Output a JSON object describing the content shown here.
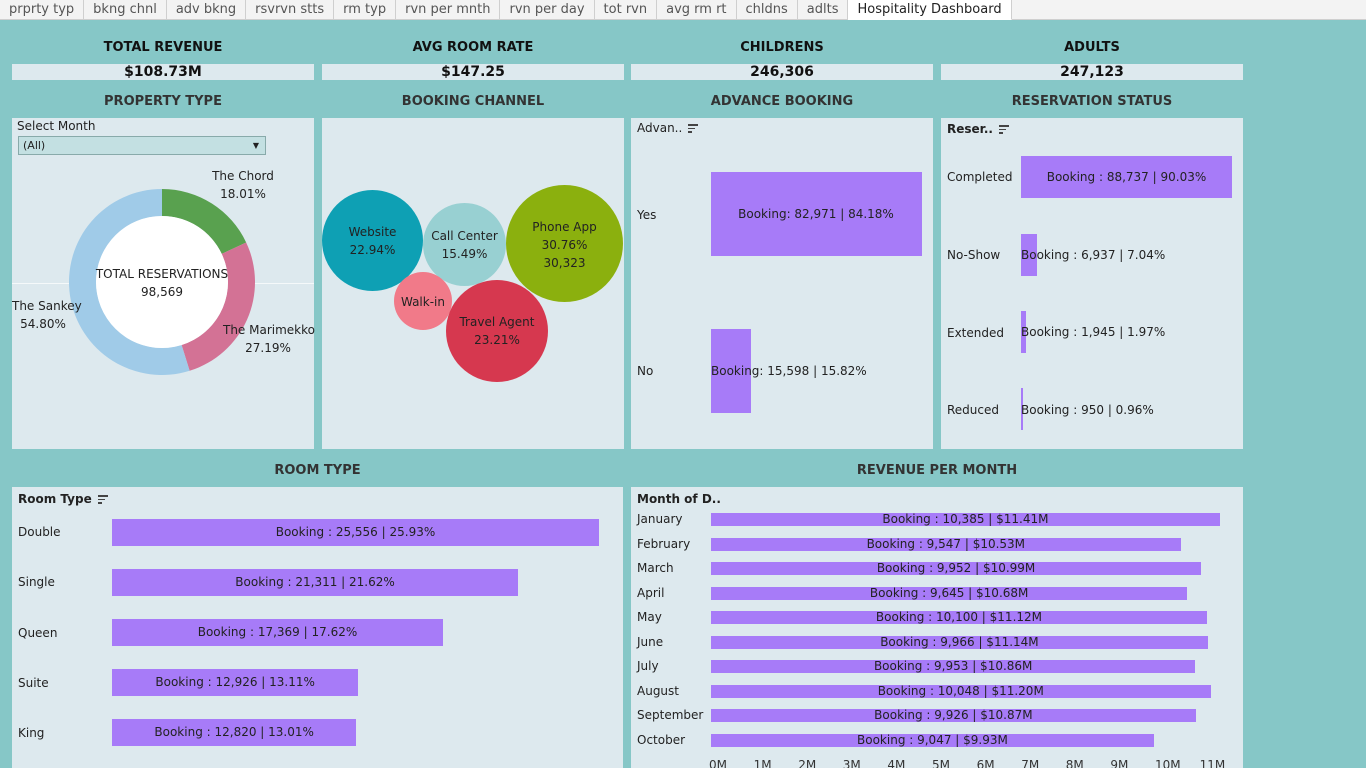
{
  "tabs": [
    "prprty typ",
    "bkng chnl",
    "adv bkng",
    "rsvrvn stts",
    "rm typ",
    "rvn per mnth",
    "rvn per day",
    "tot rvn",
    "avg rm rt",
    "chldns",
    "adlts",
    "Hospitality Dashboard"
  ],
  "active_tab_index": 11,
  "kpis": {
    "revenue": {
      "label": "TOTAL REVENUE",
      "value": "$108.73M"
    },
    "room_rate": {
      "label": "AVG ROOM RATE",
      "value": "$147.25"
    },
    "children": {
      "label": "CHILDRENS",
      "value": "246,306"
    },
    "adults": {
      "label": "ADULTS",
      "value": "247,123"
    }
  },
  "property_type": {
    "title": "PROPERTY TYPE",
    "filter_label": "Select Month",
    "filter_value": "(All)",
    "center_title": "TOTAL RESERVATIONS",
    "center_value": "98,569",
    "chart_data": {
      "type": "pie",
      "slices": [
        {
          "name": "The Chord",
          "pct_label": "18.01%",
          "value": 18.01,
          "color": "#59a14f"
        },
        {
          "name": "The Marimekko",
          "pct_label": "27.19%",
          "value": 27.19,
          "color": "#d37295"
        },
        {
          "name": "The Sankey",
          "pct_label": "54.80%",
          "value": 54.8,
          "color": "#a0cbe8"
        }
      ]
    }
  },
  "booking_channel": {
    "title": "BOOKING CHANNEL",
    "bubbles": [
      {
        "name": "Website",
        "pct": "22.94%",
        "extra": "",
        "color": "#0ea0b4"
      },
      {
        "name": "Call Center",
        "pct": "15.49%",
        "extra": "",
        "color": "#98d0d2"
      },
      {
        "name": "Phone App",
        "pct": "30.76%",
        "extra": "30,323",
        "color": "#8bb00e"
      },
      {
        "name": "Walk-in",
        "pct": "",
        "extra": "",
        "color": "#f17a89"
      },
      {
        "name": "Travel Agent",
        "pct": "23.21%",
        "extra": "",
        "color": "#d6384f"
      }
    ]
  },
  "advance_booking": {
    "title": "ADVANCE BOOKING",
    "header": "Advan..",
    "chart_data": {
      "type": "bar",
      "categories": [
        "Yes",
        "No"
      ],
      "values": [
        82971,
        15598
      ],
      "labels": [
        "Booking: 82,971 | 84.18%",
        "Booking: 15,598 | 15.82%"
      ]
    }
  },
  "reservation_status": {
    "title": "RESERVATION STATUS",
    "header": "Reser..",
    "chart_data": {
      "type": "bar",
      "categories": [
        "Completed",
        "No-Show",
        "Extended",
        "Reduced"
      ],
      "values": [
        88737,
        6937,
        1945,
        950
      ],
      "labels": [
        "Booking : 88,737 | 90.03%",
        "Booking : 6,937 | 7.04%",
        "Booking : 1,945 | 1.97%",
        "Booking : 950 | 0.96%"
      ]
    }
  },
  "room_type": {
    "title": "ROOM TYPE",
    "header": "Room Type",
    "chart_data": {
      "type": "bar",
      "categories": [
        "Double",
        "Single",
        "Queen",
        "Suite",
        "King"
      ],
      "values": [
        25556,
        21311,
        17369,
        12926,
        12820
      ],
      "labels": [
        "Booking : 25,556 | 25.93%",
        "Booking : 21,311 | 21.62%",
        "Booking : 17,369 | 17.62%",
        "Booking : 12,926 | 13.11%",
        "Booking : 12,820 | 13.01%"
      ]
    }
  },
  "revenue_month": {
    "title": "REVENUE PER MONTH",
    "header": "Month of D..",
    "chart_data": {
      "type": "bar",
      "categories": [
        "January",
        "February",
        "March",
        "April",
        "May",
        "June",
        "July",
        "August",
        "September",
        "October"
      ],
      "values": [
        11.41,
        10.53,
        10.99,
        10.68,
        11.12,
        11.14,
        10.86,
        11.2,
        10.87,
        9.93
      ],
      "labels": [
        "Booking : 10,385  | $11.41M",
        "Booking : 9,547  | $10.53M",
        "Booking : 9,952  | $10.99M",
        "Booking : 9,645  | $10.68M",
        "Booking : 10,100  | $11.12M",
        "Booking : 9,966  | $11.14M",
        "Booking : 9,953  | $10.86M",
        "Booking : 10,048  | $11.20M",
        "Booking : 9,926  | $10.87M",
        "Booking : 9,047  | $9.93M"
      ],
      "xlim": [
        0,
        11.5
      ],
      "ticks": [
        "0M",
        "1M",
        "2M",
        "3M",
        "4M",
        "5M",
        "6M",
        "7M",
        "8M",
        "9M",
        "10M",
        "11M"
      ]
    }
  },
  "colors": {
    "bar": "#a77bf8",
    "background": "#86c7c7",
    "panel": "#dde9ee"
  }
}
